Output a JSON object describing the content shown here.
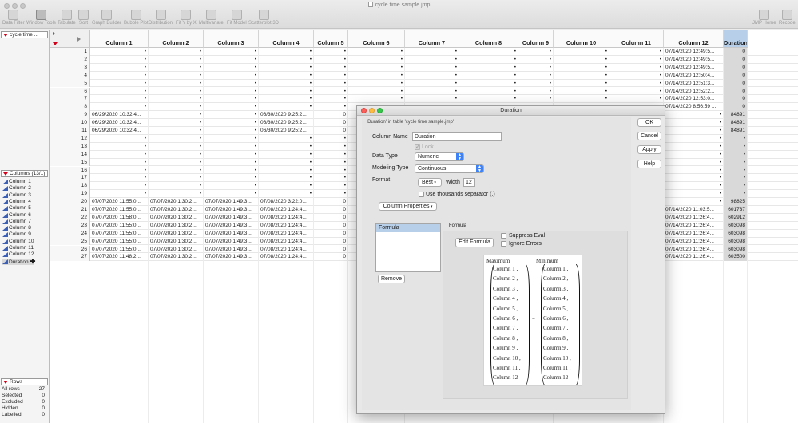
{
  "window": {
    "title": "cycle time sample.jmp"
  },
  "toolbar": {
    "left": [
      {
        "label": "Data Filter"
      },
      {
        "label": "Window Tools"
      },
      {
        "label": "Tabulate"
      },
      {
        "label": "Sort"
      },
      {
        "label": "Graph Builder"
      },
      {
        "label": "Bubble Plot"
      },
      {
        "label": "Distribution"
      },
      {
        "label": "Fit Y by X"
      },
      {
        "label": "Multivariate"
      },
      {
        "label": "Fit Model"
      },
      {
        "label": "Scatterplot 3D"
      }
    ],
    "right": [
      {
        "label": "JMP Home"
      },
      {
        "label": "Recode"
      }
    ]
  },
  "table_panel": {
    "name": "cycle time ..."
  },
  "columns_panel": {
    "header": "Columns (13/1)",
    "items": [
      "Column 1",
      "Column 2",
      "Column 3",
      "Column 4",
      "Column 5",
      "Column 6",
      "Column 7",
      "Column 8",
      "Column 9",
      "Column 10",
      "Column 11",
      "Column 12",
      "Duration"
    ],
    "formula_marker": "✚"
  },
  "rows_panel": {
    "header": "Rows",
    "items": [
      {
        "label": "All rows",
        "value": "27"
      },
      {
        "label": "Selected",
        "value": "0"
      },
      {
        "label": "Excluded",
        "value": "0"
      },
      {
        "label": "Hidden",
        "value": "0"
      },
      {
        "label": "Labelled",
        "value": "0"
      }
    ]
  },
  "grid": {
    "columns": [
      "Column 1",
      "Column 2",
      "Column 3",
      "Column 4",
      "Column 5",
      "Column 6",
      "Column 7",
      "Column 8",
      "Column 9",
      "Column 10",
      "Column 11",
      "Column 12",
      "Duration"
    ],
    "rows": [
      {
        "n": "1",
        "c": {
          "12": "07/14/2020 12:49:5...",
          "13": "0"
        }
      },
      {
        "n": "2",
        "c": {
          "12": "07/14/2020 12:49:5...",
          "13": "0"
        }
      },
      {
        "n": "3",
        "c": {
          "12": "07/14/2020 12:49:5...",
          "13": "0"
        }
      },
      {
        "n": "4",
        "c": {
          "12": "07/14/2020 12:50:4...",
          "13": "0"
        }
      },
      {
        "n": "5",
        "c": {
          "12": "07/14/2020 12:51:3...",
          "13": "0"
        }
      },
      {
        "n": "6",
        "c": {
          "12": "07/14/2020 12:52:2...",
          "13": "0"
        }
      },
      {
        "n": "7",
        "c": {
          "12": "07/14/2020 12:53:0...",
          "13": "0"
        }
      },
      {
        "n": "8",
        "c": {
          "12": "07/14/2020 8:56:59 ...",
          "13": "0"
        }
      },
      {
        "n": "9",
        "c": {
          "1": "06/29/2020 10:32:4...",
          "4": "06/30/2020 9:25:2...",
          "5": "0",
          "13": "84891"
        }
      },
      {
        "n": "10",
        "c": {
          "1": "06/29/2020 10:32:4...",
          "4": "06/30/2020 9:25:2...",
          "5": "0",
          "13": "84891"
        }
      },
      {
        "n": "11",
        "c": {
          "1": "06/29/2020 10:32:4...",
          "4": "06/30/2020 9:25:2...",
          "5": "0",
          "13": "84891"
        }
      },
      {
        "n": "12",
        "c": {}
      },
      {
        "n": "13",
        "c": {}
      },
      {
        "n": "14",
        "c": {}
      },
      {
        "n": "15",
        "c": {}
      },
      {
        "n": "16",
        "c": {}
      },
      {
        "n": "17",
        "c": {}
      },
      {
        "n": "18",
        "c": {}
      },
      {
        "n": "19",
        "c": {}
      },
      {
        "n": "20",
        "c": {
          "1": "07/07/2020 11:55:0...",
          "2": "07/07/2020 1:30:2...",
          "3": "07/07/2020 1:49:3...",
          "4": "07/08/2020 3:22:0...",
          "5": "0",
          "13": "98825"
        }
      },
      {
        "n": "21",
        "c": {
          "1": "07/07/2020 11:55:0...",
          "2": "07/07/2020 1:30:2...",
          "3": "07/07/2020 1:49:3...",
          "4": "07/08/2020 1:24:4...",
          "5": "0",
          "12": "07/14/2020 11:03:5...",
          "13": "601737"
        }
      },
      {
        "n": "22",
        "c": {
          "1": "07/07/2020 11:58:0...",
          "2": "07/07/2020 1:30:2...",
          "3": "07/07/2020 1:49:3...",
          "4": "07/08/2020 1:24:4...",
          "5": "0",
          "12": "07/14/2020 11:26:4...",
          "13": "602912"
        }
      },
      {
        "n": "23",
        "c": {
          "1": "07/07/2020 11:55:0...",
          "2": "07/07/2020 1:30:2...",
          "3": "07/07/2020 1:49:3...",
          "4": "07/08/2020 1:24:4...",
          "5": "0",
          "12": "07/14/2020 11:26:4...",
          "13": "603098"
        }
      },
      {
        "n": "24",
        "c": {
          "1": "07/07/2020 11:55:0...",
          "2": "07/07/2020 1:30:2...",
          "3": "07/07/2020 1:49:3...",
          "4": "07/08/2020 1:24:4...",
          "5": "0",
          "12": "07/14/2020 11:26:4...",
          "13": "603098"
        }
      },
      {
        "n": "25",
        "c": {
          "1": "07/07/2020 11:55:0...",
          "2": "07/07/2020 1:30:2...",
          "3": "07/07/2020 1:49:3...",
          "4": "07/08/2020 1:24:4...",
          "5": "0",
          "12": "07/14/2020 11:26:4...",
          "13": "603098"
        }
      },
      {
        "n": "26",
        "c": {
          "1": "07/07/2020 11:55:0...",
          "2": "07/07/2020 1:30:2...",
          "3": "07/07/2020 1:49:3...",
          "4": "07/08/2020 1:24:4...",
          "5": "0",
          "12": "07/14/2020 11:26:4...",
          "13": "603098"
        }
      },
      {
        "n": "27",
        "c": {
          "1": "07/07/2020 11:48:2...",
          "2": "07/07/2020 1:30:2...",
          "3": "07/07/2020 1:49:3...",
          "4": "07/08/2020 1:24:4...",
          "5": "0",
          "12": "07/14/2020 11:26:4...",
          "13": "603500"
        }
      }
    ],
    "missing_symbol": "•"
  },
  "dialog": {
    "title": "Duration",
    "subtitle": "'Duration' in table 'cycle time sample.jmp'",
    "column_name_label": "Column Name",
    "column_name_value": "Duration",
    "lock_label": "Lock",
    "data_type_label": "Data Type",
    "data_type_value": "Numeric",
    "modeling_type_label": "Modeling Type",
    "modeling_type_value": "Continuous",
    "format_label": "Format",
    "format_value": "Best",
    "width_label": "Width",
    "width_value": "12",
    "thousands_label": "Use thousands separator (,)",
    "column_properties_label": "Column Properties",
    "properties": [
      "Formula"
    ],
    "remove_label": "Remove",
    "formula_section_label": "Formula",
    "edit_formula_label": "Edit Formula",
    "suppress_eval_label": "Suppress Eval",
    "ignore_errors_label": "Ignore Errors",
    "buttons": {
      "ok": "OK",
      "cancel": "Cancel",
      "apply": "Apply",
      "help": "Help"
    },
    "formula": {
      "left_func": "Maximum",
      "right_func": "Minimum",
      "operator": "−",
      "args": [
        "Column 1 ,",
        "Column 2 ,",
        "Column 3 ,",
        "Column 4 ,",
        "Column 5 ,",
        "Column 6 ,",
        "Column 7 ,",
        "Column 8 ,",
        "Column 9 ,",
        "Column 10 ,",
        "Column 11 ,",
        "Column 12"
      ]
    }
  }
}
